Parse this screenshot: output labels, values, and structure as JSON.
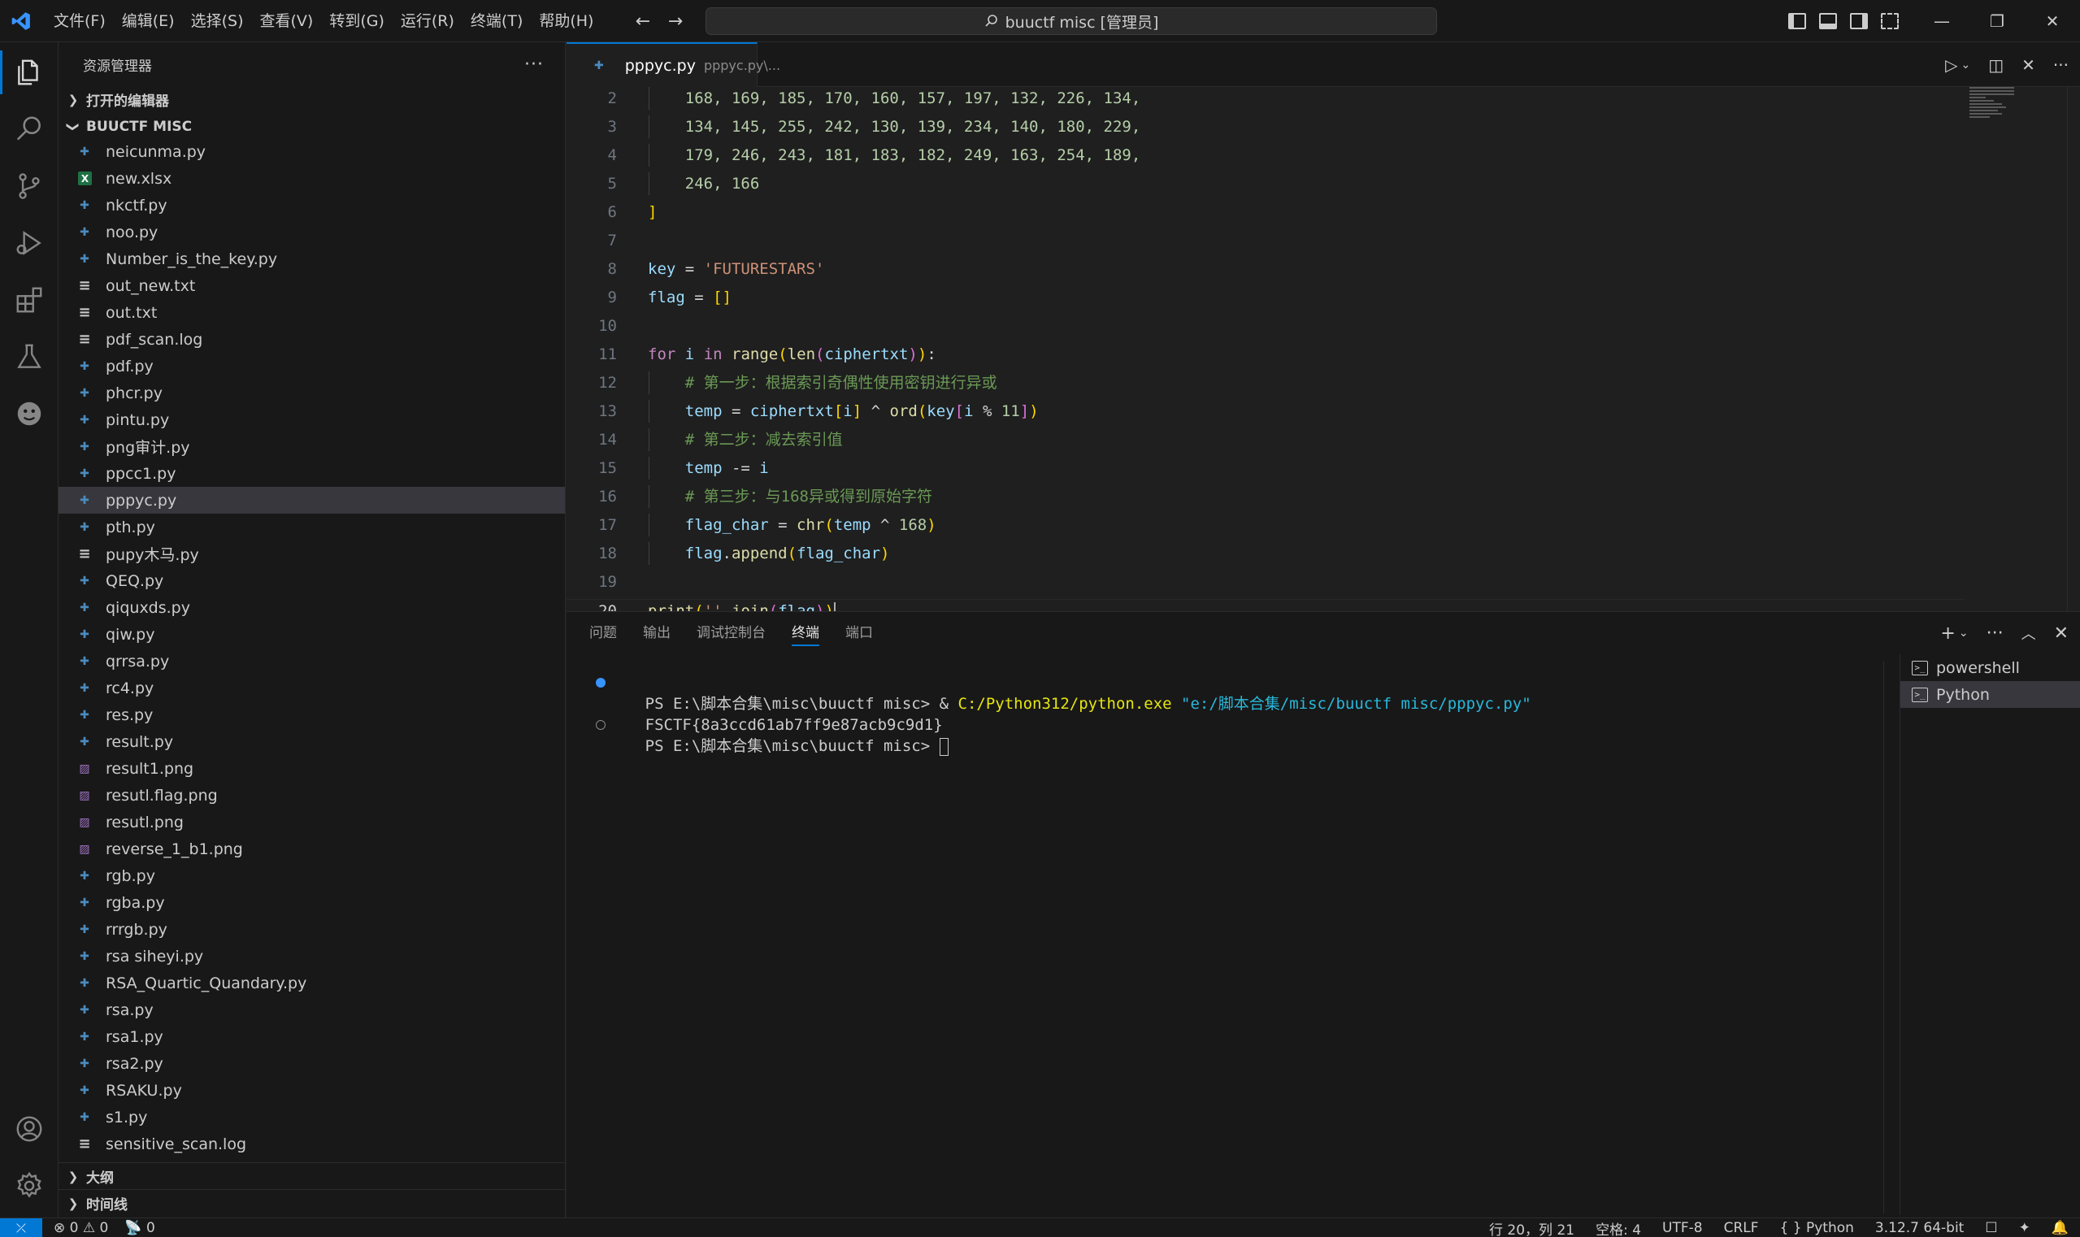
{
  "titlebar": {
    "menu": [
      "文件(F)",
      "编辑(E)",
      "选择(S)",
      "查看(V)",
      "转到(G)",
      "运行(R)",
      "终端(T)",
      "帮助(H)"
    ],
    "search_text": "buuctf misc [管理员]",
    "back_glyph": "←",
    "forward_glyph": "→",
    "minimize_glyph": "—",
    "restore_glyph": "❐",
    "close_glyph": "✕"
  },
  "sidebar": {
    "title": "资源管理器",
    "more_glyph": "···",
    "open_editors": "打开的编辑器",
    "folder": "BUUCTF MISC",
    "files": [
      {
        "name": "neicunma.py",
        "type": "py"
      },
      {
        "name": "new.xlsx",
        "type": "xlsx"
      },
      {
        "name": "nkctf.py",
        "type": "py"
      },
      {
        "name": "noo.py",
        "type": "py"
      },
      {
        "name": "Number_is_the_key.py",
        "type": "py"
      },
      {
        "name": "out_new.txt",
        "type": "txt"
      },
      {
        "name": "out.txt",
        "type": "txt"
      },
      {
        "name": "pdf_scan.log",
        "type": "txt"
      },
      {
        "name": "pdf.py",
        "type": "py"
      },
      {
        "name": "phcr.py",
        "type": "py"
      },
      {
        "name": "pintu.py",
        "type": "py"
      },
      {
        "name": "png审计.py",
        "type": "py"
      },
      {
        "name": "ppcc1.py",
        "type": "py"
      },
      {
        "name": "pppyc.py",
        "type": "py",
        "selected": true
      },
      {
        "name": "pth.py",
        "type": "py"
      },
      {
        "name": "pupy木马.py",
        "type": "txt"
      },
      {
        "name": "QEQ.py",
        "type": "py"
      },
      {
        "name": "qiquxds.py",
        "type": "py"
      },
      {
        "name": "qiw.py",
        "type": "py"
      },
      {
        "name": "qrrsa.py",
        "type": "py"
      },
      {
        "name": "rc4.py",
        "type": "py"
      },
      {
        "name": "res.py",
        "type": "py"
      },
      {
        "name": "result.py",
        "type": "py"
      },
      {
        "name": "result1.png",
        "type": "png"
      },
      {
        "name": "resutl.flag.png",
        "type": "png"
      },
      {
        "name": "resutl.png",
        "type": "png"
      },
      {
        "name": "reverse_1_b1.png",
        "type": "png"
      },
      {
        "name": "rgb.py",
        "type": "py"
      },
      {
        "name": "rgba.py",
        "type": "py"
      },
      {
        "name": "rrrgb.py",
        "type": "py"
      },
      {
        "name": "rsa siheyi.py",
        "type": "py"
      },
      {
        "name": "RSA_Quartic_Quandary.py",
        "type": "py"
      },
      {
        "name": "rsa.py",
        "type": "py"
      },
      {
        "name": "rsa1.py",
        "type": "py"
      },
      {
        "name": "rsa2.py",
        "type": "py"
      },
      {
        "name": "RSAKU.py",
        "type": "py"
      },
      {
        "name": "s1.py",
        "type": "py"
      },
      {
        "name": "sensitive_scan.log",
        "type": "txt"
      }
    ],
    "outline": "大纲",
    "timeline": "时间线"
  },
  "editor": {
    "tab_name": "pppyc.py",
    "tab_path": "pppyc.py\\...",
    "current_line": 20,
    "lines": [
      {
        "n": 2,
        "tokens": [
          [
            "    ",
            "op"
          ],
          [
            "168, 169, 185, 170, 160, 157, 197, 132, 226, 134,",
            "num"
          ]
        ]
      },
      {
        "n": 3,
        "tokens": [
          [
            "    ",
            "op"
          ],
          [
            "134, 145, 255, 242, 130, 139, 234, 140, 180, 229,",
            "num"
          ]
        ]
      },
      {
        "n": 4,
        "tokens": [
          [
            "    ",
            "op"
          ],
          [
            "179, 246, 243, 181, 183, 182, 249, 163, 254, 189,",
            "num"
          ]
        ]
      },
      {
        "n": 5,
        "tokens": [
          [
            "    ",
            "op"
          ],
          [
            "246, 166",
            "num"
          ]
        ]
      },
      {
        "n": 6,
        "tokens": [
          [
            "]",
            "br1"
          ]
        ]
      },
      {
        "n": 7,
        "tokens": []
      },
      {
        "n": 8,
        "tokens": [
          [
            "key",
            "var"
          ],
          [
            " = ",
            "op"
          ],
          [
            "'FUTURESTARS'",
            "str"
          ]
        ]
      },
      {
        "n": 9,
        "tokens": [
          [
            "flag",
            "var"
          ],
          [
            " = ",
            "op"
          ],
          [
            "[]",
            "br1"
          ]
        ]
      },
      {
        "n": 10,
        "tokens": []
      },
      {
        "n": 11,
        "tokens": [
          [
            "for",
            "kw"
          ],
          [
            " ",
            "op"
          ],
          [
            "i",
            "var"
          ],
          [
            " ",
            "op"
          ],
          [
            "in",
            "kw"
          ],
          [
            " ",
            "op"
          ],
          [
            "range",
            "fn"
          ],
          [
            "(",
            "br1"
          ],
          [
            "len",
            "fn"
          ],
          [
            "(",
            "br2"
          ],
          [
            "ciphertxt",
            "var"
          ],
          [
            ")",
            "br2"
          ],
          [
            ")",
            "br1"
          ],
          [
            ":",
            "op"
          ]
        ]
      },
      {
        "n": 12,
        "tokens": [
          [
            "    ",
            "op"
          ],
          [
            "# 第一步：根据索引奇偶性使用密钥进行异或",
            "cm"
          ]
        ]
      },
      {
        "n": 13,
        "tokens": [
          [
            "    ",
            "op"
          ],
          [
            "temp",
            "var"
          ],
          [
            " = ",
            "op"
          ],
          [
            "ciphertxt",
            "var"
          ],
          [
            "[",
            "br1"
          ],
          [
            "i",
            "var"
          ],
          [
            "]",
            "br1"
          ],
          [
            " ^ ",
            "op"
          ],
          [
            "ord",
            "fn"
          ],
          [
            "(",
            "br1"
          ],
          [
            "key",
            "var"
          ],
          [
            "[",
            "br2"
          ],
          [
            "i",
            "var"
          ],
          [
            " % ",
            "op"
          ],
          [
            "11",
            "num"
          ],
          [
            "]",
            "br2"
          ],
          [
            ")",
            "br1"
          ]
        ]
      },
      {
        "n": 14,
        "tokens": [
          [
            "    ",
            "op"
          ],
          [
            "# 第二步：减去索引值",
            "cm"
          ]
        ]
      },
      {
        "n": 15,
        "tokens": [
          [
            "    ",
            "op"
          ],
          [
            "temp",
            "var"
          ],
          [
            " -= ",
            "op"
          ],
          [
            "i",
            "var"
          ]
        ]
      },
      {
        "n": 16,
        "tokens": [
          [
            "    ",
            "op"
          ],
          [
            "# 第三步：与168异或得到原始字符",
            "cm"
          ]
        ]
      },
      {
        "n": 17,
        "tokens": [
          [
            "    ",
            "op"
          ],
          [
            "flag_char",
            "var"
          ],
          [
            " = ",
            "op"
          ],
          [
            "chr",
            "fn"
          ],
          [
            "(",
            "br1"
          ],
          [
            "temp",
            "var"
          ],
          [
            " ^ ",
            "op"
          ],
          [
            "168",
            "num"
          ],
          [
            ")",
            "br1"
          ]
        ]
      },
      {
        "n": 18,
        "tokens": [
          [
            "    ",
            "op"
          ],
          [
            "flag",
            "var"
          ],
          [
            ".",
            "op"
          ],
          [
            "append",
            "fn"
          ],
          [
            "(",
            "br1"
          ],
          [
            "flag_char",
            "var"
          ],
          [
            ")",
            "br1"
          ]
        ]
      },
      {
        "n": 19,
        "tokens": []
      },
      {
        "n": 20,
        "tokens": [
          [
            "print",
            "fn"
          ],
          [
            "(",
            "br1"
          ],
          [
            "''",
            "str"
          ],
          [
            ".",
            "op"
          ],
          [
            "join",
            "fn"
          ],
          [
            "(",
            "br2"
          ],
          [
            "flag",
            "var"
          ],
          [
            ")",
            "br2"
          ],
          [
            ")",
            "br1"
          ]
        ]
      }
    ]
  },
  "panel": {
    "tabs": [
      "问题",
      "输出",
      "调试控制台",
      "终端",
      "端口"
    ],
    "active_tab": 3,
    "terminal": {
      "line1_prompt": "PS E:\\脚本合集\\misc\\buuctf misc> & ",
      "line1_exe": "C:/Python312/python.exe",
      "line1_arg": " \"e:/脚本合集/misc/buuctf misc/pppyc.py\"",
      "line2": "FSCTF{8a3ccd61ab7ff9e87acb9c9d1}",
      "line3_prompt": "PS E:\\脚本合集\\misc\\buuctf misc> "
    },
    "shells": [
      "powershell",
      "Python"
    ],
    "active_shell": 1
  },
  "statusbar": {
    "errors": "0",
    "warnings": "0",
    "ports": "0",
    "position": "行 20，列 21",
    "spaces": "空格: 4",
    "encoding": "UTF-8",
    "eol": "CRLF",
    "language": "{ } Python",
    "interpreter": "3.12.7 64-bit"
  }
}
